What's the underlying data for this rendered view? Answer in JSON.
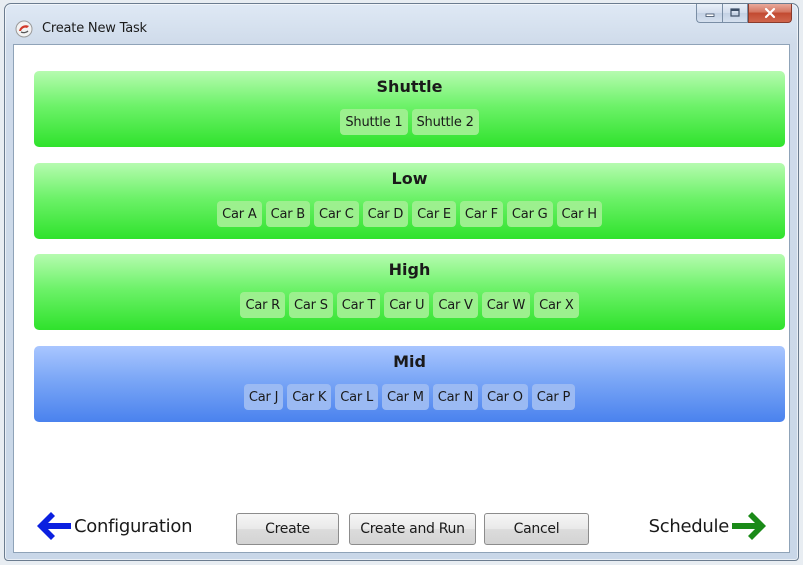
{
  "window": {
    "title": "Create New Task"
  },
  "groups": [
    {
      "title": "Shuttle",
      "color": "green",
      "items": [
        "Shuttle 1",
        "Shuttle 2"
      ]
    },
    {
      "title": "Low",
      "color": "green",
      "items": [
        "Car A",
        "Car B",
        "Car C",
        "Car D",
        "Car E",
        "Car F",
        "Car G",
        "Car H"
      ]
    },
    {
      "title": "High",
      "color": "green",
      "items": [
        "Car R",
        "Car S",
        "Car T",
        "Car U",
        "Car V",
        "Car W",
        "Car X"
      ]
    },
    {
      "title": "Mid",
      "color": "blue",
      "items": [
        "Car J",
        "Car K",
        "Car L",
        "Car M",
        "Car N",
        "Car O",
        "Car P"
      ]
    }
  ],
  "footer": {
    "back_label": "Configuration",
    "next_label": "Schedule",
    "create_label": "Create",
    "create_run_label": "Create and Run",
    "cancel_label": "Cancel"
  },
  "colors": {
    "back_arrow": "#0b20e0",
    "next_arrow": "#1a8a18"
  }
}
